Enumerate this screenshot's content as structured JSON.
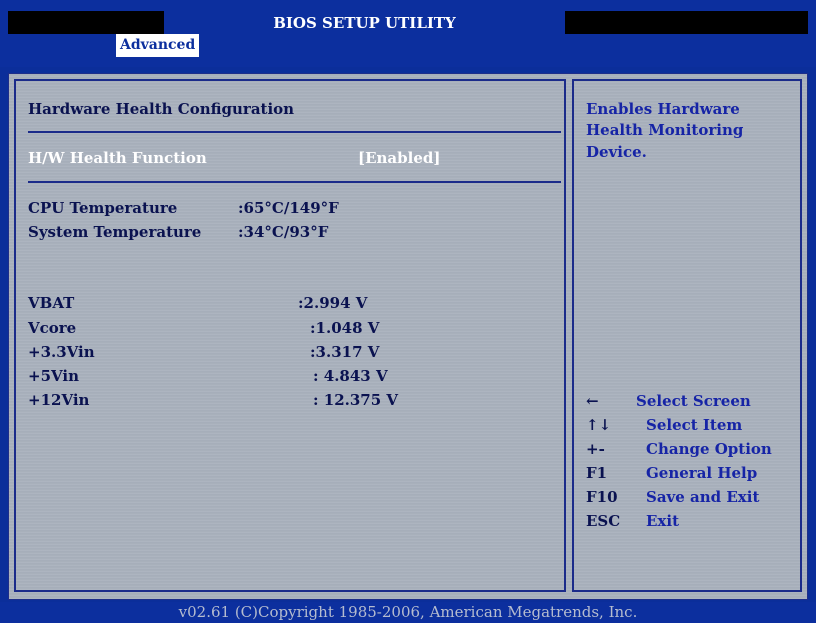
{
  "header": {
    "title": "BIOS SETUP UTILITY"
  },
  "tabs": [
    {
      "label": "Advanced",
      "active": true
    }
  ],
  "section_title": "Hardware Health Configuration",
  "hw_function": {
    "label": "H/W Health Function",
    "value": "[Enabled]"
  },
  "temperatures": [
    {
      "label": "CPU Temperature",
      "value": ":65°C/149°F"
    },
    {
      "label": "System Temperature",
      "value": ":34°C/93°F"
    }
  ],
  "voltages": [
    {
      "label": "VBAT",
      "value": ":2.994 V"
    },
    {
      "label": "Vcore",
      "value": ":1.048 V"
    },
    {
      "label": "+3.3Vin",
      "value": ":3.317 V"
    },
    {
      "label": "+5Vin",
      "value": ": 4.843 V"
    },
    {
      "label": "+12Vin",
      "value": ": 12.375 V"
    }
  ],
  "help": {
    "lines": [
      "Enables Hardware",
      "Health Monitoring",
      "Device."
    ]
  },
  "keys": [
    {
      "key": "←",
      "action": "Select Screen"
    },
    {
      "key": "↑↓",
      "action": "Select Item"
    },
    {
      "key": "+-",
      "action": "Change Option"
    },
    {
      "key": "F1",
      "action": "General Help"
    },
    {
      "key": "F10",
      "action": "Save and Exit"
    },
    {
      "key": "ESC",
      "action": "Exit"
    }
  ],
  "footer": "v02.61 (C)Copyright 1985-2006, American Megatrends, Inc.",
  "colors": {
    "bios_blue": "#0c2f9e",
    "panel_gray": "#a8b0bc",
    "highlight_text": "#ffffff",
    "accent_text": "#1624a6"
  }
}
